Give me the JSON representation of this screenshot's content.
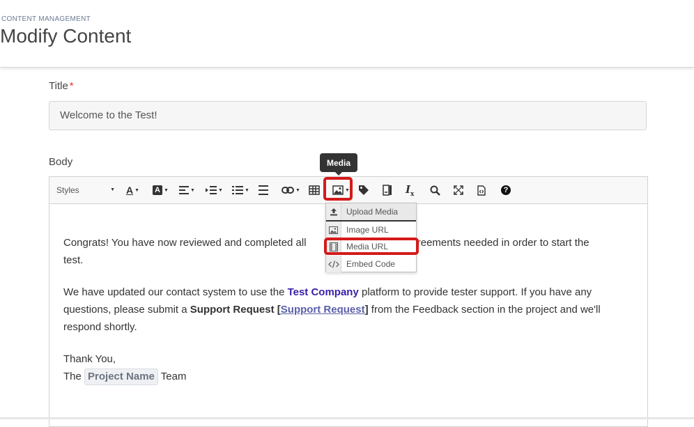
{
  "header": {
    "eyebrow": "CONTENT MANAGEMENT",
    "title": "Modify Content"
  },
  "form": {
    "title_label": "Title",
    "required_mark": "*",
    "title_value": "Welcome to the Test!",
    "body_label": "Body"
  },
  "toolbar": {
    "styles_label": "Styles",
    "tooltip": "Media",
    "icons": [
      "font-color-icon",
      "background-color-icon",
      "align-icon",
      "indent-icon",
      "list-icon",
      "horizontal-rule-icon",
      "link-icon",
      "table-icon",
      "media-icon",
      "tag-icon",
      "template-icon",
      "clear-format-icon",
      "find-icon",
      "fullscreen-icon",
      "source-icon",
      "help-icon"
    ]
  },
  "media_menu": {
    "items": [
      {
        "label": "Upload Media",
        "icon": "upload-icon"
      },
      {
        "label": "Image URL",
        "icon": "image-icon"
      },
      {
        "label": "Media URL",
        "icon": "film-icon"
      },
      {
        "label": "Embed Code",
        "icon": "code-icon"
      }
    ]
  },
  "body_content": {
    "p1_before": "Congrats! You have now reviewed and completed all",
    "p1_after": "d agreements needed in order to start the",
    "p1_line2": "test.",
    "p2_a": "We have updated our contact system to use the ",
    "p2_brand": "Test Company",
    "p2_b": " platform to provide tester support.  If you have any questions, please submit a ",
    "p2_bold": "Support Request [",
    "p2_link": "Support Request",
    "p2_close": "]",
    "p2_c": " from the Feedback section in the project and we'll respond shortly.",
    "p3_line1": "Thank You,",
    "p3_the": "The ",
    "p3_chip": "Project Name",
    "p3_team": " Team"
  },
  "colors": {
    "highlight": "#d51a1a",
    "brand": "#3b1fa8",
    "tooltip_bg": "#333333"
  }
}
